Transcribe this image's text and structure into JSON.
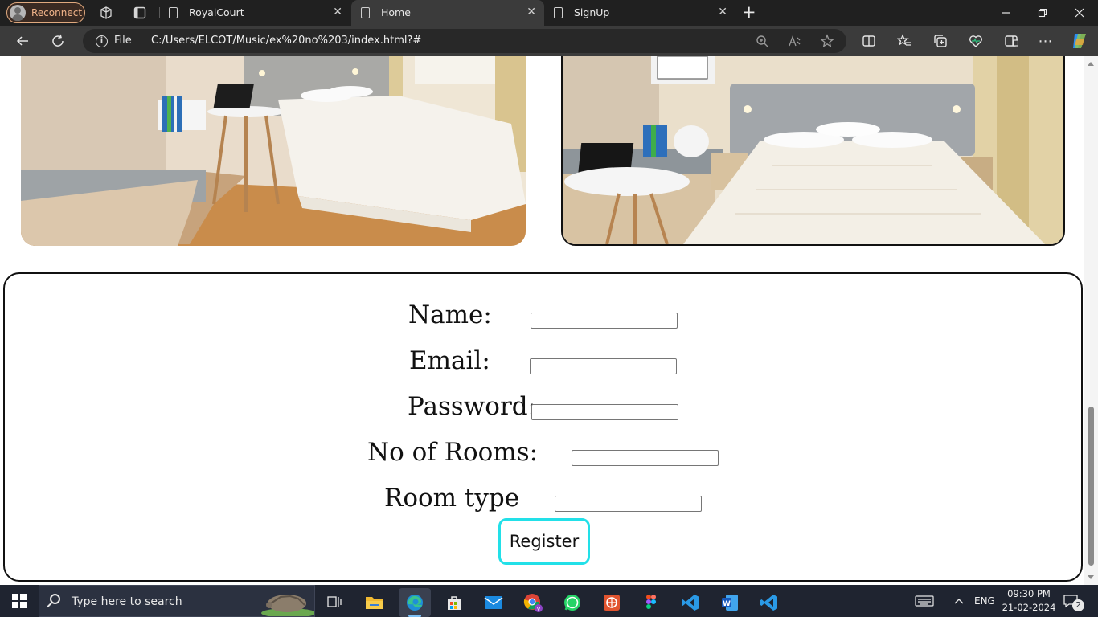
{
  "browser": {
    "profile_label": "Reconnect",
    "tabs": [
      {
        "title": "RoyalCourt",
        "active": false
      },
      {
        "title": "Home",
        "active": true
      },
      {
        "title": "SignUp",
        "active": false
      }
    ],
    "new_tab_symbol": "+",
    "address": {
      "scheme_label": "File",
      "url": "C:/Users/ELCOT/Music/ex%20no%203/index.html?#"
    }
  },
  "page": {
    "images": [
      {
        "icon": "bedroom-photo-1"
      },
      {
        "icon": "bedroom-photo-2"
      }
    ],
    "form": {
      "fields": [
        {
          "label": "Name:",
          "value": ""
        },
        {
          "label": "Email:",
          "value": ""
        },
        {
          "label": "Password:",
          "value": ""
        },
        {
          "label": "No of Rooms:",
          "value": ""
        },
        {
          "label": "Room type",
          "value": ""
        }
      ],
      "submit_label": "Register",
      "submit_border_color": "#22e0e8"
    }
  },
  "taskbar": {
    "search_placeholder": "Type here to search",
    "apps": [
      "task-view",
      "file-explorer",
      "edge",
      "microsoft-store",
      "mail",
      "chrome",
      "whatsapp",
      "app-red",
      "figma",
      "vscode",
      "word",
      "vscode"
    ],
    "language": "ENG",
    "time": "09:30 PM",
    "date": "21-02-2024",
    "notification_count": "2"
  }
}
